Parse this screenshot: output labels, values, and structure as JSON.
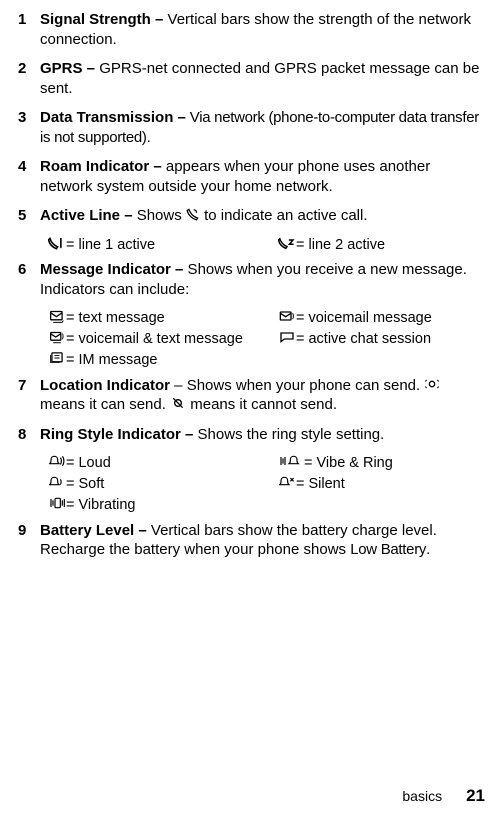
{
  "footer": {
    "section": "basics",
    "page": "21"
  },
  "items": {
    "i1": {
      "num": "1",
      "title": "Signal Strength –",
      "desc": " Vertical bars show the strength of the network connection."
    },
    "i2": {
      "num": "2",
      "title": "GPRS –",
      "desc": " GPRS-net connected and GPRS packet message can be sent."
    },
    "i3": {
      "num": "3",
      "title": "Data Transmission –",
      "desc": " Via network (phone-to-computer data transfer is not supported)."
    },
    "i4": {
      "num": "4",
      "title": "Roam Indicator –",
      "desc": " appears when your phone uses another network system outside your home network."
    },
    "i5": {
      "num": "5",
      "title": "Active Line –",
      "desc_pre": " Shows ",
      "desc_post": " to indicate an active call."
    },
    "i6": {
      "num": "6",
      "title": "Message Indicator –",
      "desc": " Shows when you receive a new message. Indicators can include:"
    },
    "i7": {
      "num": "7",
      "title": "Location Indicator",
      "desc_pre": " – Shows when your phone can send. ",
      "desc_mid": " means it can send. ",
      "desc_post": " means it cannot send."
    },
    "i8": {
      "num": "8",
      "title": "Ring Style Indicator –",
      "desc": " Shows the ring style setting."
    },
    "i9": {
      "num": "9",
      "title": "Battery Level –",
      "desc_pre": " Vertical bars show the battery charge level. Recharge the battery when your phone shows ",
      "desc_post": ".",
      "lowbatt": "Low Battery"
    }
  },
  "sub_line": {
    "l1": "= line 1 active",
    "l2": "= line 2 active"
  },
  "sub_msg": {
    "text": "= text message",
    "vmail": "= voicemail message",
    "vtext": "= voicemail & text message",
    "chat": "= active chat session",
    "im": "= IM message"
  },
  "sub_ring": {
    "loud": " = Loud",
    "vibe_ring": " = Vibe & Ring",
    "soft": " = Soft",
    "silent": " = Silent",
    "vibrating": " = Vibrating"
  }
}
